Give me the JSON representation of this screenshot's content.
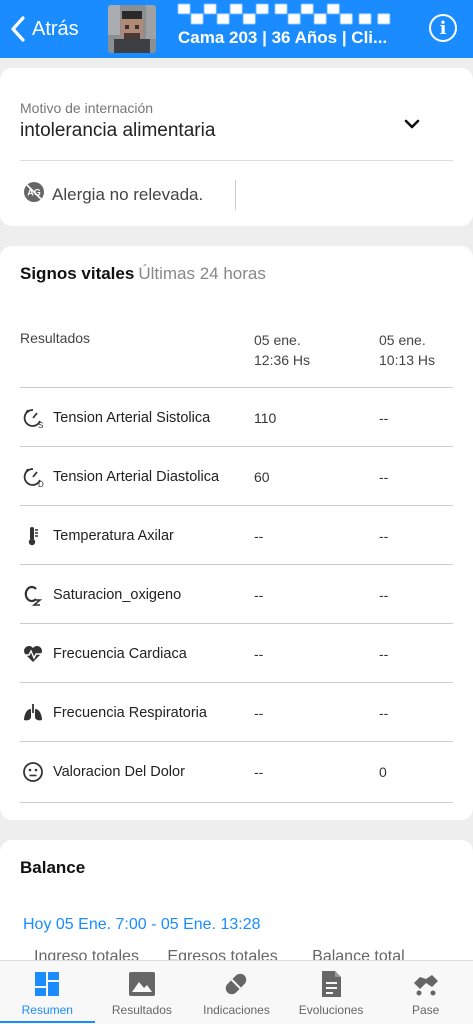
{
  "header": {
    "back_label": "Atrás",
    "patient_name": "▀▄▀▄▀▄▀ ▀▄▀▄▀▄ ▄ ▄",
    "patient_sub": "Cama 203 | 36 Años | Cli...",
    "info_label": "i"
  },
  "motivo": {
    "label": "Motivo de internación",
    "value": "intolerancia alimentaria",
    "allergy_text": "Alergia no relevada."
  },
  "vitals": {
    "title": "Signos vitales",
    "subtitle": "Últimas 24 horas",
    "results_header": "Resultados",
    "col1": "05 ene.\n12:36 Hs",
    "col2": "05 ene.\n10:13 Hs",
    "rows": [
      {
        "label": "Tension Arterial Sistolica",
        "v1": "110",
        "v2": "--",
        "icon": "blood-pressure-s-icon"
      },
      {
        "label": "Tension Arterial Diastolica",
        "v1": "60",
        "v2": "--",
        "icon": "blood-pressure-d-icon"
      },
      {
        "label": "Temperatura Axilar",
        "v1": "--",
        "v2": "--",
        "icon": "thermometer-icon"
      },
      {
        "label": "Saturacion_oxigeno",
        "v1": "--",
        "v2": "--",
        "icon": "oxygen-icon"
      },
      {
        "label": "Frecuencia Cardiaca",
        "v1": "--",
        "v2": "--",
        "icon": "heart-rate-icon"
      },
      {
        "label": "Frecuencia Respiratoria",
        "v1": "--",
        "v2": "--",
        "icon": "lungs-icon"
      },
      {
        "label": "Valoracion Del Dolor",
        "v1": "--",
        "v2": "0",
        "icon": "pain-face-icon"
      }
    ]
  },
  "balance": {
    "title": "Balance",
    "range": "Hoy 05 Ene. 7:00 - 05 Ene. 13:28",
    "col_ingreso": "Ingreso totales",
    "col_egreso": "Egresos totales",
    "col_balance": "Balance total"
  },
  "nav": {
    "resumen": "Resumen",
    "resultados": "Resultados",
    "indicaciones": "Indicaciones",
    "evoluciones": "Evoluciones",
    "pase": "Pase"
  },
  "colors": {
    "primary": "#1a8cff",
    "background": "#eeeeee"
  }
}
